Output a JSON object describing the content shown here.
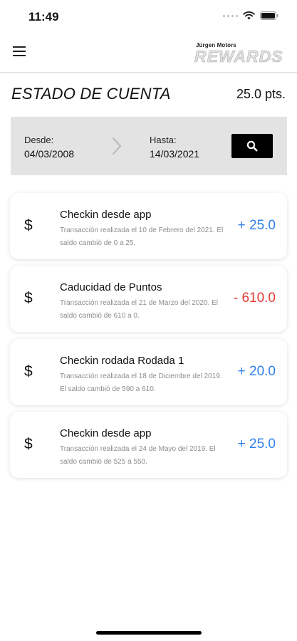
{
  "status_bar": {
    "time": "11:49"
  },
  "header": {
    "brand_top": "Jürgen Motors",
    "brand_main": "REWARDS"
  },
  "page": {
    "title": "ESTADO DE CUENTA",
    "balance": "25.0 pts."
  },
  "filter": {
    "from_label": "Desde:",
    "from_value": "04/03/2008",
    "to_label": "Hasta:",
    "to_value": "14/03/2021"
  },
  "transactions": [
    {
      "icon": "$",
      "title": "Checkin desde app",
      "description": "Transacción realizada el 10 de Febrero del 2021. El saldo cambió de 0 a 25.",
      "amount": "+ 25.0",
      "sign": "positive"
    },
    {
      "icon": "$",
      "title": "Caducidad de Puntos",
      "description": "Transacción realizada el 21 de Marzo del 2020. El saldo cambió de 610 a 0.",
      "amount": "- 610.0",
      "sign": "negative"
    },
    {
      "icon": "$",
      "title": "Checkin rodada Rodada 1",
      "description": "Transacción realizada el 18 de Diciembre del 2019. El saldo cambió de 590 a 610.",
      "amount": "+ 20.0",
      "sign": "positive"
    },
    {
      "icon": "$",
      "title": "Checkin desde app",
      "description": "Transacción realizada el 24 de Mayo del 2019. El saldo cambió de 525 a 550.",
      "amount": "+ 25.0",
      "sign": "positive"
    }
  ],
  "colors": {
    "positive": "#2f80ed",
    "negative": "#e53935",
    "filter_bg": "#e3e3e3",
    "search_button": "#000000"
  }
}
